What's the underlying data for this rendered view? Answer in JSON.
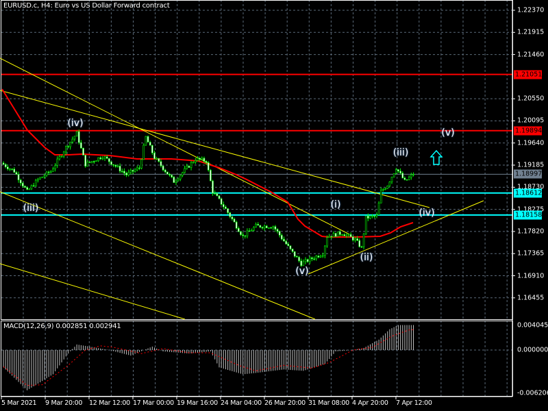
{
  "header": {
    "title": "EURUSD.c, H4:  Euro vs US Dollar Forward contract"
  },
  "price_axis": [
    "1.22370",
    "1.21915",
    "1.21460",
    "1.20550",
    "1.20095",
    "1.19640",
    "1.19185",
    "1.18730",
    "1.18275",
    "1.17820",
    "1.17365",
    "1.16910",
    "1.16455"
  ],
  "levels": [
    {
      "price": 1.21051,
      "label": "1.21051",
      "color": "#ff0000"
    },
    {
      "price": 1.19894,
      "label": "1.19894",
      "color": "#ff0000"
    },
    {
      "price": 1.18997,
      "label": "1.18997",
      "color": "#708090"
    },
    {
      "price": 1.18612,
      "label": "1.18612",
      "color": "#00ffff"
    },
    {
      "price": 1.18158,
      "label": "1.18158",
      "color": "#00ffff"
    }
  ],
  "time_axis": [
    "5 Mar 2021",
    "9 Mar 20:00",
    "12 Mar 12:00",
    "17 Mar 00:00",
    "19 Mar 16:00",
    "24 Mar 04:00",
    "26 Mar 20:00",
    "31 Mar 08:00",
    "4 Apr 20:00",
    "7 Apr 12:00"
  ],
  "waves": [
    "(iii)",
    "(iv)",
    "(v)",
    "(i)",
    "(ii)",
    "(iii)",
    "(iv)",
    "(v)"
  ],
  "macd": {
    "label": "MACD(12,26,9) 0.002851 0.002941",
    "axis": [
      "0.004045",
      "0.000000",
      "-0.006206"
    ]
  },
  "colors": {
    "bull": "#00ff00",
    "ma": "#ff0000",
    "trend": "#ffff00",
    "grid": "#5c6b7a",
    "histogram": "#c0c0c0",
    "signal": "#ff0000",
    "arrow": "#00ffff"
  },
  "chart_data": {
    "type": "candlestick",
    "symbol": "EURUSD.c",
    "timeframe": "H4",
    "ylim": [
      1.1623,
      1.2255
    ],
    "close_keypoints": [
      [
        0,
        1.192
      ],
      [
        5,
        1.1906
      ],
      [
        11,
        1.1864
      ],
      [
        16,
        1.1889
      ],
      [
        22,
        1.1906
      ],
      [
        29,
        1.1955
      ],
      [
        34,
        1.1984
      ],
      [
        38,
        1.192
      ],
      [
        46,
        1.1937
      ],
      [
        51,
        1.192
      ],
      [
        57,
        1.1899
      ],
      [
        63,
        1.1913
      ],
      [
        66,
        1.1976
      ],
      [
        70,
        1.1934
      ],
      [
        79,
        1.1885
      ],
      [
        89,
        1.1931
      ],
      [
        94,
        1.1927
      ],
      [
        97,
        1.1864
      ],
      [
        103,
        1.1828
      ],
      [
        111,
        1.1772
      ],
      [
        117,
        1.1793
      ],
      [
        125,
        1.1793
      ],
      [
        133,
        1.1744
      ],
      [
        138,
        1.1716
      ],
      [
        148,
        1.1737
      ],
      [
        150,
        1.1772
      ],
      [
        157,
        1.1779
      ],
      [
        163,
        1.1765
      ],
      [
        166,
        1.1748
      ],
      [
        168,
        1.181
      ],
      [
        173,
        1.1814
      ],
      [
        175,
        1.1864
      ],
      [
        178,
        1.1878
      ],
      [
        182,
        1.1913
      ],
      [
        186,
        1.1885
      ],
      [
        190,
        1.18997
      ]
    ],
    "macd_histogram": [
      [
        0,
        -0.0025
      ],
      [
        11,
        -0.0058
      ],
      [
        23,
        -0.0035
      ],
      [
        30,
        -0.0005
      ],
      [
        34,
        0.0008
      ],
      [
        40,
        0.0005
      ],
      [
        49,
        0.0
      ],
      [
        59,
        -0.0008
      ],
      [
        69,
        0.0005
      ],
      [
        74,
        -0.0002
      ],
      [
        86,
        -0.0005
      ],
      [
        96,
        -0.0002
      ],
      [
        100,
        -0.0025
      ],
      [
        111,
        -0.0035
      ],
      [
        117,
        -0.0033
      ],
      [
        130,
        -0.0028
      ],
      [
        139,
        -0.003
      ],
      [
        149,
        -0.002
      ],
      [
        154,
        -0.0002
      ],
      [
        162,
        0.0
      ],
      [
        167,
        0.0003
      ],
      [
        174,
        0.0015
      ],
      [
        179,
        0.003
      ],
      [
        183,
        0.0036
      ],
      [
        190,
        0.0036
      ]
    ],
    "macd_signal": [
      [
        0,
        -0.0024
      ],
      [
        11,
        -0.0051
      ],
      [
        18,
        -0.005
      ],
      [
        30,
        -0.0022
      ],
      [
        38,
        0.0
      ],
      [
        45,
        0.0006
      ],
      [
        51,
        0.0004
      ],
      [
        64,
        -0.0005
      ],
      [
        74,
        0.0002
      ],
      [
        86,
        -0.0004
      ],
      [
        96,
        -0.0004
      ],
      [
        109,
        -0.0022
      ],
      [
        117,
        -0.003
      ],
      [
        130,
        -0.0022
      ],
      [
        143,
        -0.0026
      ],
      [
        151,
        -0.0018
      ],
      [
        162,
        0.0
      ],
      [
        171,
        0.0004
      ],
      [
        180,
        0.002
      ],
      [
        188,
        0.0029
      ],
      [
        190,
        0.00294
      ]
    ]
  }
}
